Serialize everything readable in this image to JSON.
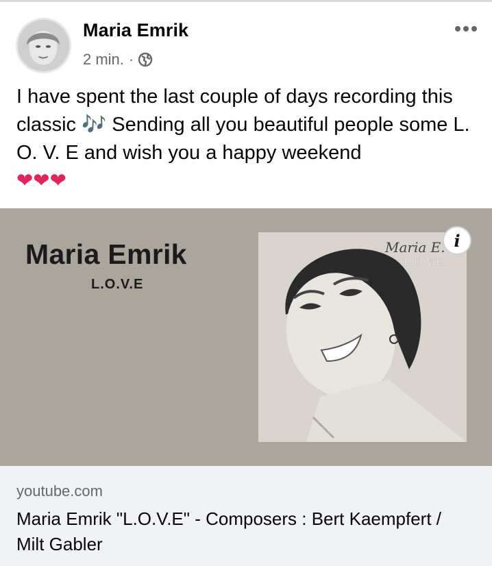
{
  "post": {
    "author": "Maria Emrik",
    "time": "2 min.",
    "separator": "·",
    "text": "I have spent the last couple of days recording this classic 🎶 Sending all you beautiful people some L. O. V. E and wish you a happy weekend",
    "hearts": "❤❤❤",
    "more_icon": "more-horizontal-icon",
    "privacy_icon": "globe-icon"
  },
  "preview": {
    "artist": "Maria Emrik",
    "song": "L.O.V.E",
    "album_name": "Maria E.",
    "album_sub": "L.O.V.E",
    "info_label": "i",
    "background": "#aaa59d"
  },
  "link": {
    "domain": "youtube.com",
    "title": "Maria Emrik \"L.O.V.E\" - Composers : Bert Kaempfert / Milt Gabler"
  }
}
